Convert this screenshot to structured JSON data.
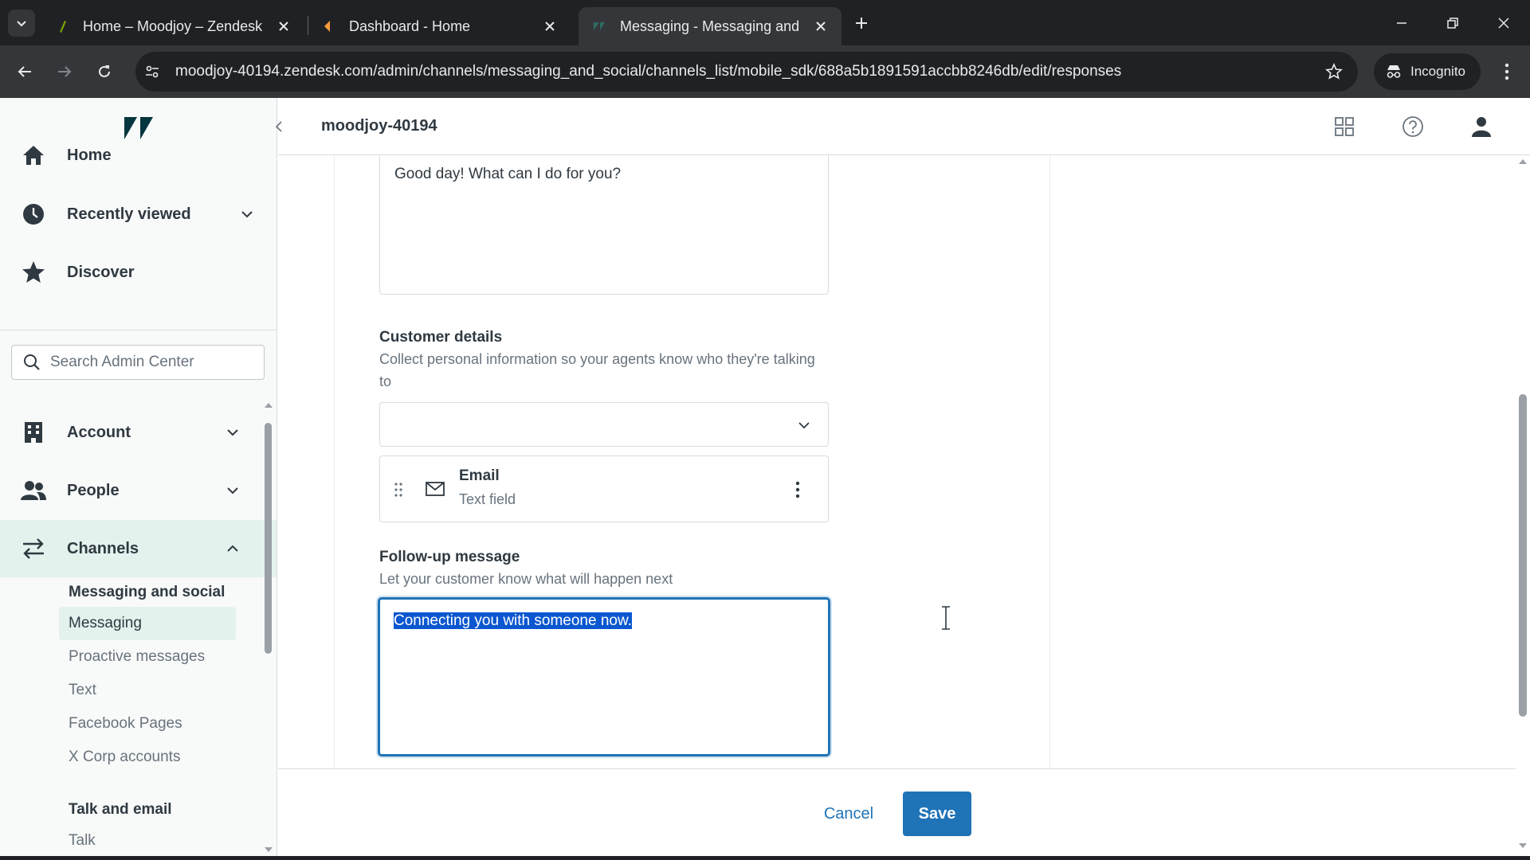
{
  "browser": {
    "tabs": [
      {
        "title": "Home – Moodjoy – Zendesk",
        "active": false
      },
      {
        "title": "Dashboard - Home",
        "active": false
      },
      {
        "title": "Messaging - Messaging and so",
        "active": true
      }
    ],
    "url": "moodjoy-40194.zendesk.com/admin/channels/messaging_and_social/channels_list/mobile_sdk/688a5b1891591accbb8246db/edit/responses",
    "profile_label": "Incognito"
  },
  "header": {
    "subdomain": "moodjoy-40194"
  },
  "sidebar": {
    "top_items": [
      {
        "label": "Home",
        "icon": "home-icon"
      },
      {
        "label": "Recently viewed",
        "icon": "clock-icon"
      },
      {
        "label": "Discover",
        "icon": "star-icon"
      }
    ],
    "search_placeholder": "Search Admin Center",
    "sections": [
      {
        "label": "Account",
        "icon": "building-icon",
        "expanded": false
      },
      {
        "label": "People",
        "icon": "people-icon",
        "expanded": false
      },
      {
        "label": "Channels",
        "icon": "arrows-icon",
        "expanded": true
      }
    ],
    "channels_groups": [
      {
        "title": "Messaging and social",
        "items": [
          "Messaging",
          "Proactive messages",
          "Text",
          "Facebook Pages",
          "X Corp accounts"
        ],
        "selected": "Messaging"
      },
      {
        "title": "Talk and email",
        "items": [
          "Talk"
        ]
      }
    ]
  },
  "form": {
    "greeting_message": "Good day! What can I do for you?",
    "customer_details": {
      "label": "Customer details",
      "hint": "Collect personal information so your agents know who they're talking to",
      "select_value": "",
      "fields": [
        {
          "name": "Email",
          "type": "Text field"
        }
      ]
    },
    "followup": {
      "label": "Follow-up message",
      "hint": "Let your customer know what will happen next",
      "value": "Connecting you with someone now."
    }
  },
  "footer": {
    "cancel_label": "Cancel",
    "save_label": "Save"
  },
  "colors": {
    "brand_green": "#03363d",
    "primary_blue": "#1f73b7",
    "selection": "#0b57d0",
    "active_nav_bg": "#e4f2ee"
  }
}
